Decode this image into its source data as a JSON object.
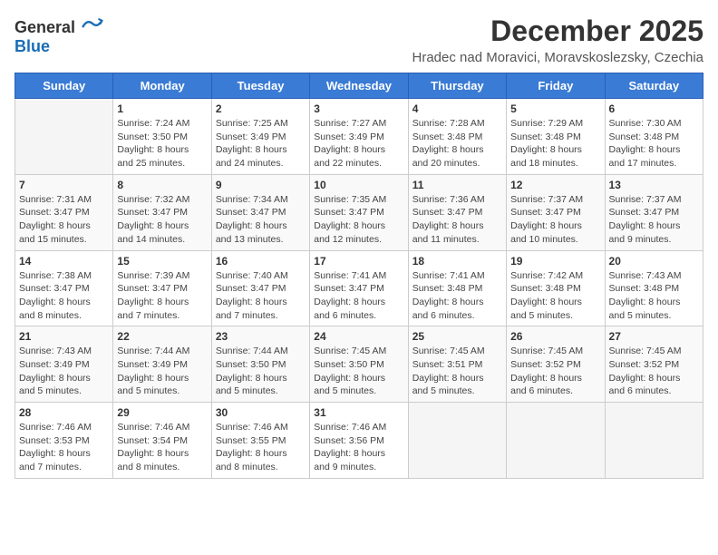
{
  "logo": {
    "general": "General",
    "blue": "Blue"
  },
  "title": "December 2025",
  "subtitle": "Hradec nad Moravici, Moravskoslezsky, Czechia",
  "header": {
    "days": [
      "Sunday",
      "Monday",
      "Tuesday",
      "Wednesday",
      "Thursday",
      "Friday",
      "Saturday"
    ]
  },
  "weeks": [
    [
      {
        "day": "",
        "info": ""
      },
      {
        "day": "1",
        "info": "Sunrise: 7:24 AM\nSunset: 3:50 PM\nDaylight: 8 hours\nand 25 minutes."
      },
      {
        "day": "2",
        "info": "Sunrise: 7:25 AM\nSunset: 3:49 PM\nDaylight: 8 hours\nand 24 minutes."
      },
      {
        "day": "3",
        "info": "Sunrise: 7:27 AM\nSunset: 3:49 PM\nDaylight: 8 hours\nand 22 minutes."
      },
      {
        "day": "4",
        "info": "Sunrise: 7:28 AM\nSunset: 3:48 PM\nDaylight: 8 hours\nand 20 minutes."
      },
      {
        "day": "5",
        "info": "Sunrise: 7:29 AM\nSunset: 3:48 PM\nDaylight: 8 hours\nand 18 minutes."
      },
      {
        "day": "6",
        "info": "Sunrise: 7:30 AM\nSunset: 3:48 PM\nDaylight: 8 hours\nand 17 minutes."
      }
    ],
    [
      {
        "day": "7",
        "info": "Sunrise: 7:31 AM\nSunset: 3:47 PM\nDaylight: 8 hours\nand 15 minutes."
      },
      {
        "day": "8",
        "info": "Sunrise: 7:32 AM\nSunset: 3:47 PM\nDaylight: 8 hours\nand 14 minutes."
      },
      {
        "day": "9",
        "info": "Sunrise: 7:34 AM\nSunset: 3:47 PM\nDaylight: 8 hours\nand 13 minutes."
      },
      {
        "day": "10",
        "info": "Sunrise: 7:35 AM\nSunset: 3:47 PM\nDaylight: 8 hours\nand 12 minutes."
      },
      {
        "day": "11",
        "info": "Sunrise: 7:36 AM\nSunset: 3:47 PM\nDaylight: 8 hours\nand 11 minutes."
      },
      {
        "day": "12",
        "info": "Sunrise: 7:37 AM\nSunset: 3:47 PM\nDaylight: 8 hours\nand 10 minutes."
      },
      {
        "day": "13",
        "info": "Sunrise: 7:37 AM\nSunset: 3:47 PM\nDaylight: 8 hours\nand 9 minutes."
      }
    ],
    [
      {
        "day": "14",
        "info": "Sunrise: 7:38 AM\nSunset: 3:47 PM\nDaylight: 8 hours\nand 8 minutes."
      },
      {
        "day": "15",
        "info": "Sunrise: 7:39 AM\nSunset: 3:47 PM\nDaylight: 8 hours\nand 7 minutes."
      },
      {
        "day": "16",
        "info": "Sunrise: 7:40 AM\nSunset: 3:47 PM\nDaylight: 8 hours\nand 7 minutes."
      },
      {
        "day": "17",
        "info": "Sunrise: 7:41 AM\nSunset: 3:47 PM\nDaylight: 8 hours\nand 6 minutes."
      },
      {
        "day": "18",
        "info": "Sunrise: 7:41 AM\nSunset: 3:48 PM\nDaylight: 8 hours\nand 6 minutes."
      },
      {
        "day": "19",
        "info": "Sunrise: 7:42 AM\nSunset: 3:48 PM\nDaylight: 8 hours\nand 5 minutes."
      },
      {
        "day": "20",
        "info": "Sunrise: 7:43 AM\nSunset: 3:48 PM\nDaylight: 8 hours\nand 5 minutes."
      }
    ],
    [
      {
        "day": "21",
        "info": "Sunrise: 7:43 AM\nSunset: 3:49 PM\nDaylight: 8 hours\nand 5 minutes."
      },
      {
        "day": "22",
        "info": "Sunrise: 7:44 AM\nSunset: 3:49 PM\nDaylight: 8 hours\nand 5 minutes."
      },
      {
        "day": "23",
        "info": "Sunrise: 7:44 AM\nSunset: 3:50 PM\nDaylight: 8 hours\nand 5 minutes."
      },
      {
        "day": "24",
        "info": "Sunrise: 7:45 AM\nSunset: 3:50 PM\nDaylight: 8 hours\nand 5 minutes."
      },
      {
        "day": "25",
        "info": "Sunrise: 7:45 AM\nSunset: 3:51 PM\nDaylight: 8 hours\nand 5 minutes."
      },
      {
        "day": "26",
        "info": "Sunrise: 7:45 AM\nSunset: 3:52 PM\nDaylight: 8 hours\nand 6 minutes."
      },
      {
        "day": "27",
        "info": "Sunrise: 7:45 AM\nSunset: 3:52 PM\nDaylight: 8 hours\nand 6 minutes."
      }
    ],
    [
      {
        "day": "28",
        "info": "Sunrise: 7:46 AM\nSunset: 3:53 PM\nDaylight: 8 hours\nand 7 minutes."
      },
      {
        "day": "29",
        "info": "Sunrise: 7:46 AM\nSunset: 3:54 PM\nDaylight: 8 hours\nand 8 minutes."
      },
      {
        "day": "30",
        "info": "Sunrise: 7:46 AM\nSunset: 3:55 PM\nDaylight: 8 hours\nand 8 minutes."
      },
      {
        "day": "31",
        "info": "Sunrise: 7:46 AM\nSunset: 3:56 PM\nDaylight: 8 hours\nand 9 minutes."
      },
      {
        "day": "",
        "info": ""
      },
      {
        "day": "",
        "info": ""
      },
      {
        "day": "",
        "info": ""
      }
    ]
  ]
}
